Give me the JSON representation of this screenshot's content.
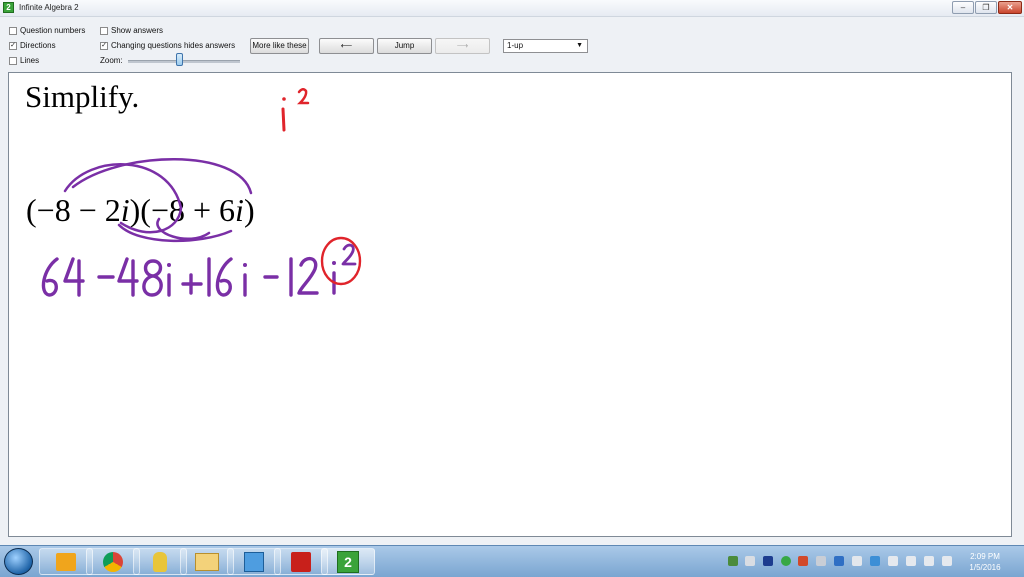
{
  "window": {
    "title": "Infinite Algebra 2"
  },
  "toolbar": {
    "options": [
      {
        "label": "Question numbers",
        "checked": false
      },
      {
        "label": "Directions",
        "checked": true
      },
      {
        "label": "Lines",
        "checked": false
      },
      {
        "label": "Show answers",
        "checked": false
      },
      {
        "label": "Changing questions hides answers",
        "checked": true
      }
    ],
    "more_like_these": "More like these",
    "prev": "⟵",
    "jump": "Jump",
    "next": "⟶",
    "zoom_label": "Zoom:",
    "layout_select": "1-up"
  },
  "worksheet": {
    "heading": "Simplify.",
    "problem": {
      "factor1": "(−8 − 2",
      "factor1_i": "i",
      "factor2": ")(−8 + 6",
      "factor2_i": "i",
      "close": ")"
    },
    "annotations": {
      "note_top": "i²",
      "expansion": "64 −48i +16i −12i²"
    }
  },
  "colors": {
    "ink_red": "#e0242b",
    "ink_purple": "#7a2fa6"
  },
  "taskbar": {
    "apps": [
      "outlook-icon",
      "chrome-icon",
      "pointer-app-icon",
      "file-explorer-icon",
      "notepad-icon",
      "acrobat-icon",
      "infinite-algebra-icon"
    ],
    "clock_time": "2:09 PM",
    "clock_date": "1/5/2016"
  }
}
